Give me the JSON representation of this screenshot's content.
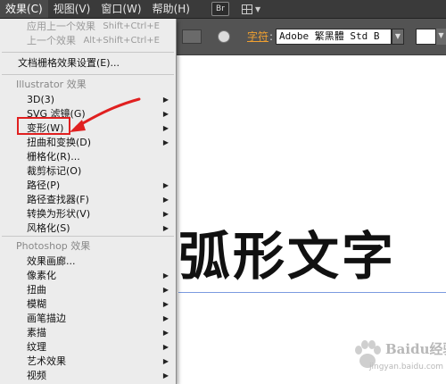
{
  "menubar": {
    "items": [
      "效果(C)",
      "视图(V)",
      "窗口(W)",
      "帮助(H)"
    ],
    "br_badge": "Br"
  },
  "controlbar": {
    "font_label": "字符",
    "colon": ":",
    "font_value": "Adobe 繁黑體 Std B"
  },
  "menu": {
    "top_items": [
      {
        "label": "应用上一个效果",
        "shortcut": "Shift+Ctrl+E"
      },
      {
        "label": "上一个效果",
        "shortcut": "Alt+Shift+Ctrl+E"
      }
    ],
    "doc_raster": "文档栅格效果设置(E)...",
    "illustrator_header": "Illustrator 效果",
    "illustrator_items": [
      {
        "label": "3D(3)",
        "submenu": true
      },
      {
        "label": "SVG 滤镜(G)",
        "submenu": true
      },
      {
        "label": "变形(W)",
        "submenu": true
      },
      {
        "label": "扭曲和变换(D)",
        "submenu": true
      },
      {
        "label": "栅格化(R)...",
        "submenu": false
      },
      {
        "label": "裁剪标记(O)",
        "submenu": false
      },
      {
        "label": "路径(P)",
        "submenu": true
      },
      {
        "label": "路径查找器(F)",
        "submenu": true
      },
      {
        "label": "转换为形状(V)",
        "submenu": true
      },
      {
        "label": "风格化(S)",
        "submenu": true
      }
    ],
    "photoshop_header": "Photoshop 效果",
    "photoshop_items": [
      {
        "label": "效果画廊...",
        "submenu": false
      },
      {
        "label": "像素化",
        "submenu": true
      },
      {
        "label": "扭曲",
        "submenu": true
      },
      {
        "label": "模糊",
        "submenu": true
      },
      {
        "label": "画笔描边",
        "submenu": true
      },
      {
        "label": "素描",
        "submenu": true
      },
      {
        "label": "纹理",
        "submenu": true
      },
      {
        "label": "艺术效果",
        "submenu": true
      },
      {
        "label": "视频",
        "submenu": true
      }
    ]
  },
  "canvas": {
    "text": "弧形文字"
  },
  "watermark": {
    "line1": "Baidu经验",
    "line2": "jingyan.baidu.com"
  },
  "colors": {
    "menubar_bg": "#3a3a3a",
    "controlbar_bg": "#535353",
    "menu_bg": "#ececec",
    "accent_orange": "#f0a030",
    "highlight_red": "#e02020"
  }
}
